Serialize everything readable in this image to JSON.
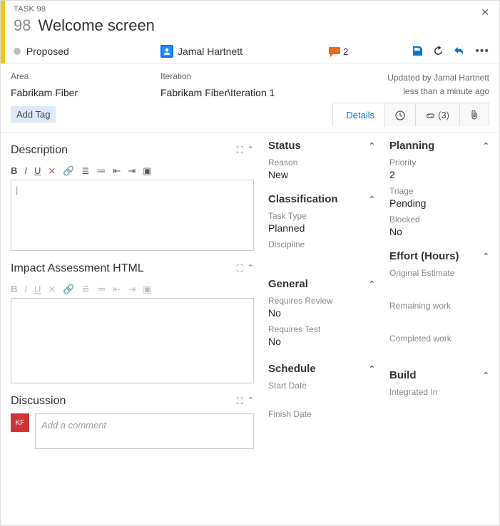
{
  "header": {
    "type_label": "TASK 98",
    "id": "98",
    "title": "Welcome screen",
    "state": "Proposed",
    "assignee": "Jamal Hartnett",
    "comment_count": "2"
  },
  "info": {
    "area_label": "Area",
    "area_value": "Fabrikam Fiber",
    "iteration_label": "Iteration",
    "iteration_value": "Fabrikam Fiber\\Iteration 1",
    "updated_by": "Updated by Jamal Hartnett",
    "updated_when": "less than a minute ago",
    "add_tag": "Add Tag"
  },
  "tabs": {
    "details": "Details",
    "links_count": "(3)"
  },
  "left": {
    "description": "Description",
    "impact": "Impact Assessment HTML",
    "discussion": "Discussion",
    "comment_placeholder": "Add a comment"
  },
  "status": {
    "heading": "Status",
    "reason_label": "Reason",
    "reason_value": "New"
  },
  "classification": {
    "heading": "Classification",
    "tasktype_label": "Task Type",
    "tasktype_value": "Planned",
    "discipline_label": "Discipline"
  },
  "general": {
    "heading": "General",
    "review_label": "Requires Review",
    "review_value": "No",
    "test_label": "Requires Test",
    "test_value": "No"
  },
  "schedule": {
    "heading": "Schedule",
    "start_label": "Start Date",
    "finish_label": "Finish Date"
  },
  "planning": {
    "heading": "Planning",
    "priority_label": "Priority",
    "priority_value": "2",
    "triage_label": "Triage",
    "triage_value": "Pending",
    "blocked_label": "Blocked",
    "blocked_value": "No"
  },
  "effort": {
    "heading": "Effort (Hours)",
    "orig_label": "Original Estimate",
    "remain_label": "Remaining work",
    "complete_label": "Completed work"
  },
  "build": {
    "heading": "Build",
    "integrated_label": "Integrated In"
  }
}
